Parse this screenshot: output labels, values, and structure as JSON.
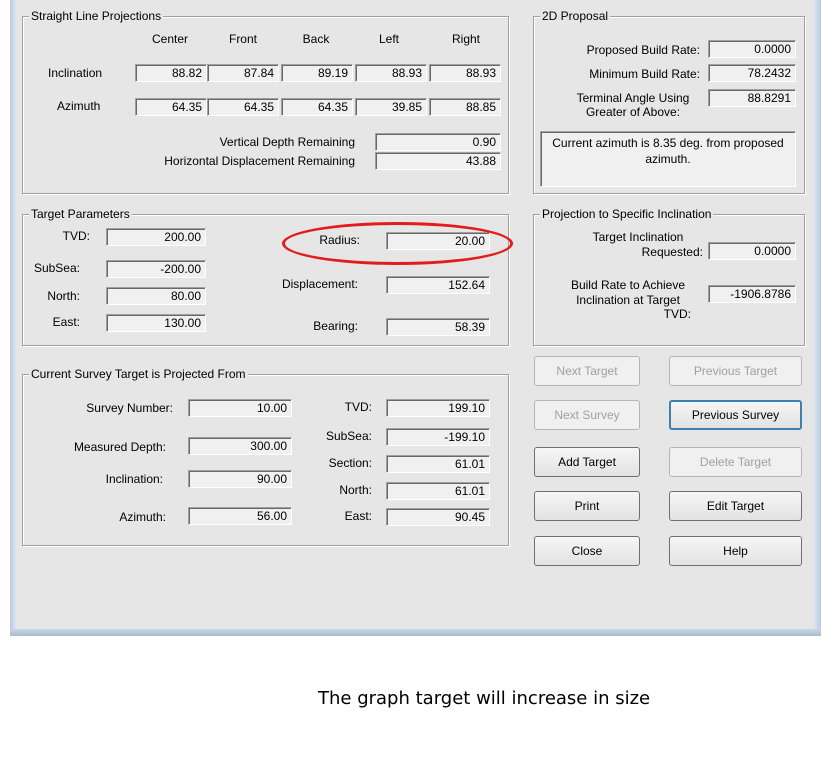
{
  "straight_line": {
    "title": "Straight Line Projections",
    "columns": [
      "Center",
      "Front",
      "Back",
      "Left",
      "Right"
    ],
    "rows": [
      {
        "label": "Inclination",
        "values": [
          "88.82",
          "87.84",
          "89.19",
          "88.93",
          "88.93"
        ]
      },
      {
        "label": "Azimuth",
        "values": [
          "64.35",
          "64.35",
          "64.35",
          "39.85",
          "88.85"
        ]
      }
    ],
    "vdr_label": "Vertical Depth Remaining",
    "vdr_value": "0.90",
    "hdr_label": "Horizontal Displacement Remaining",
    "hdr_value": "43.88"
  },
  "proposal": {
    "title": "2D Proposal",
    "build_rate_label": "Proposed Build Rate:",
    "build_rate_value": "0.0000",
    "min_build_label": "Minimum Build Rate:",
    "min_build_value": "78.2432",
    "terminal_label_1": "Terminal Angle Using",
    "terminal_label_2": "Greater of Above:",
    "terminal_value": "88.8291",
    "message": "Current azimuth is 8.35 deg. from proposed azimuth."
  },
  "target_params": {
    "title": "Target Parameters",
    "tvd_label": "TVD:",
    "tvd_value": "200.00",
    "subsea_label": "SubSea:",
    "subsea_value": "-200.00",
    "north_label": "North:",
    "north_value": "80.00",
    "east_label": "East:",
    "east_value": "130.00",
    "radius_label": "Radius:",
    "radius_value": "20.00",
    "displacement_label": "Displacement:",
    "displacement_value": "152.64",
    "bearing_label": "Bearing:",
    "bearing_value": "58.39"
  },
  "specific_inclination": {
    "title": "Projection to Specific Inclination",
    "target_inc_label_1": "Target Inclination",
    "target_inc_label_2": "Requested:",
    "target_inc_value": "0.0000",
    "build_label_1": "Build Rate to Achieve",
    "build_label_2": "Inclination at Target",
    "build_label_3": "TVD:",
    "build_value": "-1906.8786"
  },
  "survey": {
    "title": "Current Survey Target is Projected From",
    "survey_number_label": "Survey Number:",
    "survey_number_value": "10.00",
    "md_label": "Measured Depth:",
    "md_value": "300.00",
    "inclination_label": "Inclination:",
    "inclination_value": "90.00",
    "azimuth_label": "Azimuth:",
    "azimuth_value": "56.00",
    "tvd_label": "TVD:",
    "tvd_value": "199.10",
    "subsea_label": "SubSea:",
    "subsea_value": "-199.10",
    "section_label": "Section:",
    "section_value": "61.01",
    "north_label": "North:",
    "north_value": "61.01",
    "east_label": "East:",
    "east_value": "90.45"
  },
  "buttons": {
    "next_target": "Next Target",
    "previous_target": "Previous Target",
    "next_survey": "Next Survey",
    "previous_survey": "Previous Survey",
    "add_target": "Add Target",
    "delete_target": "Delete Target",
    "print": "Print",
    "edit_target": "Edit Target",
    "close": "Close",
    "help": "Help"
  },
  "annotation": {
    "highlight_color": "#e31b1b",
    "caption": "The graph target will increase in size"
  }
}
